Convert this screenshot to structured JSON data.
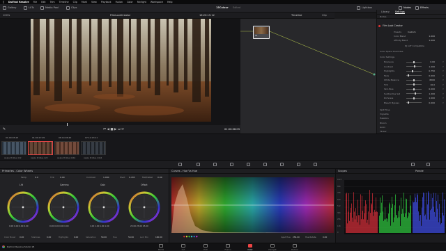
{
  "menubar": {
    "app_name": "DaVinci Resolve",
    "items": [
      "File",
      "Edit",
      "Trim",
      "Timeline",
      "Clip",
      "Mark",
      "View",
      "Playback",
      "Fusion",
      "Color",
      "Fairlight",
      "Workspace",
      "Help"
    ]
  },
  "toolbar": {
    "gallery_label": "Gallery",
    "luts_label": "LUTs",
    "media_pool_label": "Media Pool",
    "clips_label": "Clips",
    "project_title": "15Colour",
    "project_status": "Edited",
    "lightbox_label": "Lightbox",
    "node_label": "Nodes",
    "effects_label": "Effects"
  },
  "viewer": {
    "zoom": "100%",
    "clip_name": "FilmLookCreator",
    "timecode_top": "16:20:15:12",
    "timeline_label": "Timeline",
    "clip_label": "Clip",
    "playhead_timecode": "01:00:06:03"
  },
  "effects_panel": {
    "tabs": [
      "Library",
      "Settings"
    ],
    "active_tab": "Settings",
    "search_label": "Nodes",
    "effect_name": "Film Look Creator",
    "preset_label": "Presets",
    "preset_value": "Custom",
    "params_top": [
      {
        "label": "Color Blend",
        "value": "1.000"
      },
      {
        "label": "Affinity Blend",
        "value": "1.000"
      }
    ],
    "compat_note": "DJ LUT Compatible",
    "section_color_space": "Color Space Overrides",
    "section_color_settings": "Color Settings",
    "color_params": [
      {
        "label": "Exposure",
        "value": "0.00",
        "pos": 0.5
      },
      {
        "label": "Contrast",
        "value": "1.200",
        "pos": 0.55
      },
      {
        "label": "Highlights",
        "value": "0.750",
        "pos": 0.4
      },
      {
        "label": "Fade",
        "value": "0.000",
        "pos": 0.1
      },
      {
        "label": "White Balance",
        "value": "6500",
        "pos": 0.5
      },
      {
        "label": "Tint",
        "value": "10.0",
        "pos": 0.5
      },
      {
        "label": "Skin Bias",
        "value": "0.000",
        "pos": 0.5
      },
      {
        "label": "Subtractive Sat",
        "value": "1.200",
        "pos": 0.6
      },
      {
        "label": "Richness",
        "value": "1.000",
        "pos": 0.5
      },
      {
        "label": "Bleach Bypass",
        "value": "0.000",
        "pos": 0.1
      }
    ],
    "sections_collapsed": [
      "Split Tone",
      "Vignette",
      "Halation",
      "Bloom",
      "Grain",
      "Flicker"
    ]
  },
  "clips": [
    {
      "timecode": "01:00:05:23",
      "name": "Apple ProRes 422",
      "color": "#3a4a5a",
      "active": false
    },
    {
      "timecode": "01:00:17:05",
      "name": "Apple ProRes 422",
      "color": "#5a3a2a",
      "active": true
    },
    {
      "timecode": "06:14:06:20",
      "name": "Apple ProRes 4444",
      "color": "#6a4030",
      "active": false
    },
    {
      "timecode": "07:12:13:11",
      "name": "Apple ProRes 4444",
      "color": "#2a3038",
      "active": false
    }
  ],
  "primaries": {
    "title": "Primaries - Color Wheels",
    "temp_label": "Temp",
    "temp_value": "0.0",
    "tint_label": "Tint",
    "tint_value": "0.00",
    "contrast_label": "Contrast",
    "contrast_value": "1.000",
    "pivot_label": "Pivot",
    "pivot_value": "0.435",
    "middetail_label": "Mid/Detail",
    "middetail_value": "0.00",
    "wheels": [
      {
        "label": "Lift",
        "values": "0.00  0.00  0.00  0.00"
      },
      {
        "label": "Gamma",
        "values": "0.00  0.00  0.00  0.00"
      },
      {
        "label": "Gain",
        "values": "1.00  1.00  1.00  1.00"
      },
      {
        "label": "Offset",
        "values": "25.00  25.00  25.00"
      }
    ],
    "bottom": [
      {
        "label": "Color Boost",
        "value": "0.00"
      },
      {
        "label": "Shadows",
        "value": "0.00"
      },
      {
        "label": "Highlights",
        "value": "0.00"
      },
      {
        "label": "Saturation",
        "value": "50.00"
      },
      {
        "label": "Hue",
        "value": "50.00"
      },
      {
        "label": "Lum Mix",
        "value": "100.00"
      }
    ]
  },
  "curves": {
    "title": "Curves - Hue Vs Hue",
    "input_hue_label": "Input Hue",
    "input_hue_value": "256.00",
    "hue_rotate_label": "Hue Rotate",
    "hue_rotate_value": "0.00"
  },
  "scopes": {
    "title": "Scopes",
    "mode": "Parade",
    "scale": [
      "1023",
      "896",
      "768",
      "640",
      "512",
      "384",
      "256",
      "128",
      "0"
    ]
  },
  "bottombar": {
    "app_label": "DaVinci Resolve Studio 18",
    "pages": [
      "Media",
      "Cut",
      "Edit",
      "Fusion",
      "Color",
      "Fairlight",
      "Deliver"
    ],
    "active_page": "Color"
  }
}
